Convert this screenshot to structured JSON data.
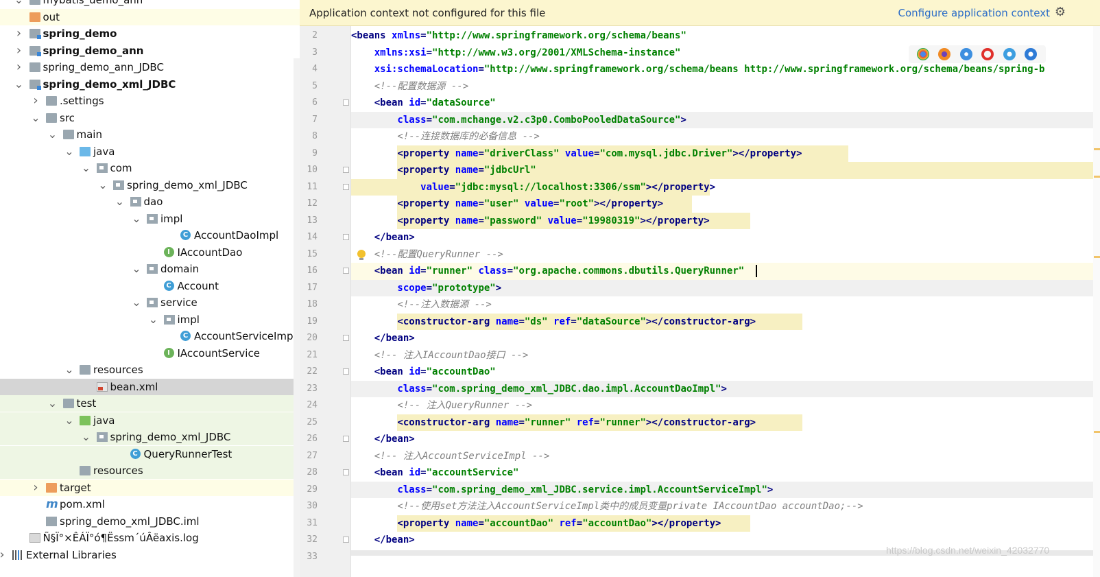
{
  "tree": {
    "items": [
      {
        "label": "mybatis_demo_ann",
        "arrow": "v",
        "icon": "folder-icon",
        "bold": false
      },
      {
        "label": "out",
        "arrow": "",
        "icon": "folder-icon",
        "bold": false
      },
      {
        "label": "spring_demo",
        "arrow": ">",
        "icon": "folder-icon",
        "bold": true
      },
      {
        "label": "spring_demo_ann",
        "arrow": ">",
        "icon": "folder-icon",
        "bold": true
      },
      {
        "label": "spring_demo_ann_JDBC",
        "arrow": ">",
        "icon": "folder-icon",
        "bold": false
      },
      {
        "label": "spring_demo_xml_JDBC",
        "arrow": "v",
        "icon": "folder-icon",
        "bold": true
      },
      {
        "label": ".settings",
        "arrow": ">",
        "icon": "folder-icon",
        "bold": false
      },
      {
        "label": "src",
        "arrow": "v",
        "icon": "folder-icon",
        "bold": false
      },
      {
        "label": "main",
        "arrow": "v",
        "icon": "folder-icon",
        "bold": false
      },
      {
        "label": "java",
        "arrow": "v",
        "icon": "folder-icon",
        "bold": false
      },
      {
        "label": "com",
        "arrow": "v",
        "icon": "package-icon",
        "bold": false
      },
      {
        "label": "spring_demo_xml_JDBC",
        "arrow": "v",
        "icon": "package-icon",
        "bold": false
      },
      {
        "label": "dao",
        "arrow": "v",
        "icon": "package-icon",
        "bold": false
      },
      {
        "label": "impl",
        "arrow": "v",
        "icon": "package-icon",
        "bold": false
      },
      {
        "label": "AccountDaoImpl",
        "arrow": "",
        "icon": "class-icon",
        "bold": false
      },
      {
        "label": "IAccountDao",
        "arrow": "",
        "icon": "interface-icon",
        "bold": false
      },
      {
        "label": "domain",
        "arrow": "v",
        "icon": "package-icon",
        "bold": false
      },
      {
        "label": "Account",
        "arrow": "",
        "icon": "class-icon",
        "bold": false
      },
      {
        "label": "service",
        "arrow": "v",
        "icon": "package-icon",
        "bold": false
      },
      {
        "label": "impl",
        "arrow": "v",
        "icon": "package-icon",
        "bold": false
      },
      {
        "label": "AccountServiceImpl",
        "arrow": "",
        "icon": "class-icon",
        "bold": false
      },
      {
        "label": "IAccountService",
        "arrow": "",
        "icon": "interface-icon",
        "bold": false
      },
      {
        "label": "resources",
        "arrow": "v",
        "icon": "folder-icon",
        "bold": false
      },
      {
        "label": "bean.xml",
        "arrow": "",
        "icon": "xml-file-icon",
        "bold": false
      },
      {
        "label": "test",
        "arrow": "v",
        "icon": "folder-icon",
        "bold": false
      },
      {
        "label": "java",
        "arrow": "v",
        "icon": "folder-icon",
        "bold": false
      },
      {
        "label": "spring_demo_xml_JDBC",
        "arrow": "v",
        "icon": "package-icon",
        "bold": false
      },
      {
        "label": "QueryRunnerTest",
        "arrow": "",
        "icon": "test-class-icon",
        "bold": false
      },
      {
        "label": "resources",
        "arrow": "",
        "icon": "folder-icon",
        "bold": false
      },
      {
        "label": "target",
        "arrow": ">",
        "icon": "folder-icon",
        "bold": false
      },
      {
        "label": "pom.xml",
        "arrow": "",
        "icon": "maven-icon",
        "bold": false
      },
      {
        "label": "spring_demo_xml_JDBC.iml",
        "arrow": "",
        "icon": "iml-file-icon",
        "bold": false
      },
      {
        "label": "Ñ§Ï°×ÊÁÏ°ó¶Ëssm´úÂëaxis.log",
        "arrow": "",
        "icon": "log-file-icon",
        "bold": false
      },
      {
        "label": "External Libraries",
        "arrow": ">",
        "icon": "library-icon",
        "bold": false
      }
    ]
  },
  "banner": {
    "message": "Application context not configured for this file",
    "link": "Configure application context"
  },
  "editor": {
    "line_numbers": [
      "2",
      "3",
      "4",
      "5",
      "6",
      "7",
      "8",
      "9",
      "10",
      "11",
      "12",
      "13",
      "14",
      "15",
      "16",
      "17",
      "18",
      "19",
      "20",
      "21",
      "22",
      "23",
      "24",
      "25",
      "26",
      "27",
      "28",
      "29",
      "30",
      "31",
      "32",
      "33"
    ],
    "lines": [
      [
        [
          "tag",
          "<beans "
        ],
        [
          "attr",
          "xmlns"
        ],
        [
          "tag",
          "="
        ],
        [
          "val",
          "\"http://www.springframework.org/schema/beans\""
        ]
      ],
      [
        [
          "attr",
          "    xmlns:xsi"
        ],
        [
          "tag",
          "="
        ],
        [
          "val",
          "\"http://www.w3.org/2001/XMLSchema-instance\""
        ]
      ],
      [
        [
          "attr",
          "    xsi:schemaLocation"
        ],
        [
          "tag",
          "="
        ],
        [
          "val",
          "\"http://www.springframework.org/schema/beans http://www.springframework.org/schema/beans/spring-b"
        ]
      ],
      [
        [
          "cmt",
          "    <!--配置数据源 -->"
        ]
      ],
      [
        [
          "tag",
          "    <bean "
        ],
        [
          "attr",
          "id"
        ],
        [
          "tag",
          "="
        ],
        [
          "val",
          "\"dataSource\""
        ]
      ],
      [
        [
          "attr",
          "        class"
        ],
        [
          "tag",
          "="
        ],
        [
          "val",
          "\"com.mchange.v2.c3p0.ComboPooledDataSource\""
        ],
        [
          "tag",
          ">"
        ]
      ],
      [
        [
          "cmt",
          "        <!--连接数据库的必备信息 -->"
        ]
      ],
      [
        [
          "tag",
          "        <property "
        ],
        [
          "attr",
          "name"
        ],
        [
          "tag",
          "="
        ],
        [
          "val",
          "\"driverClass\" "
        ],
        [
          "attr",
          "value"
        ],
        [
          "tag",
          "="
        ],
        [
          "val",
          "\"com.mysql.jdbc.Driver\""
        ],
        [
          "tag",
          "></property>"
        ]
      ],
      [
        [
          "tag",
          "        <property "
        ],
        [
          "attr",
          "name"
        ],
        [
          "tag",
          "="
        ],
        [
          "val",
          "\"jdbcUrl\""
        ]
      ],
      [
        [
          "attr",
          "            value"
        ],
        [
          "tag",
          "="
        ],
        [
          "val",
          "\"jdbc:mysql://localhost:3306/ssm\""
        ],
        [
          "tag",
          "></property>"
        ]
      ],
      [
        [
          "tag",
          "        <property "
        ],
        [
          "attr",
          "name"
        ],
        [
          "tag",
          "="
        ],
        [
          "val",
          "\"user\" "
        ],
        [
          "attr",
          "value"
        ],
        [
          "tag",
          "="
        ],
        [
          "val",
          "\"root\""
        ],
        [
          "tag",
          "></property>"
        ]
      ],
      [
        [
          "tag",
          "        <property "
        ],
        [
          "attr",
          "name"
        ],
        [
          "tag",
          "="
        ],
        [
          "val",
          "\"password\" "
        ],
        [
          "attr",
          "value"
        ],
        [
          "tag",
          "="
        ],
        [
          "val",
          "\"19980319\""
        ],
        [
          "tag",
          "></property>"
        ]
      ],
      [
        [
          "tag",
          "    </bean>"
        ]
      ],
      [
        [
          "cmt",
          "    <!--配置QueryRunner -->"
        ]
      ],
      [
        [
          "tag",
          "    <bean "
        ],
        [
          "attr",
          "id"
        ],
        [
          "tag",
          "="
        ],
        [
          "val",
          "\"runner\" "
        ],
        [
          "attr",
          "class"
        ],
        [
          "tag",
          "="
        ],
        [
          "val",
          "\"org.apache.commons.dbutils.QueryRunner\""
        ]
      ],
      [
        [
          "attr",
          "        scope"
        ],
        [
          "tag",
          "="
        ],
        [
          "val",
          "\"prototype\""
        ],
        [
          "tag",
          ">"
        ]
      ],
      [
        [
          "cmt",
          "        <!--注入数据源 -->"
        ]
      ],
      [
        [
          "tag",
          "        <constructor-arg "
        ],
        [
          "attr",
          "name"
        ],
        [
          "tag",
          "="
        ],
        [
          "val",
          "\"ds\" "
        ],
        [
          "attr",
          "ref"
        ],
        [
          "tag",
          "="
        ],
        [
          "val",
          "\"dataSource\""
        ],
        [
          "tag",
          "></constructor-arg>"
        ]
      ],
      [
        [
          "tag",
          "    </bean>"
        ]
      ],
      [
        [
          "cmt",
          "    <!-- 注入IAccountDao接口 -->"
        ]
      ],
      [
        [
          "tag",
          "    <bean "
        ],
        [
          "attr",
          "id"
        ],
        [
          "tag",
          "="
        ],
        [
          "val",
          "\"accountDao\""
        ]
      ],
      [
        [
          "attr",
          "        class"
        ],
        [
          "tag",
          "="
        ],
        [
          "val",
          "\"com.spring_demo_xml_JDBC.dao.impl.AccountDaoImpl\""
        ],
        [
          "tag",
          ">"
        ]
      ],
      [
        [
          "cmt",
          "        <!-- 注入QueryRunner -->"
        ]
      ],
      [
        [
          "tag",
          "        <constructor-arg "
        ],
        [
          "attr",
          "name"
        ],
        [
          "tag",
          "="
        ],
        [
          "val",
          "\"runner\" "
        ],
        [
          "attr",
          "ref"
        ],
        [
          "tag",
          "="
        ],
        [
          "val",
          "\"runner\""
        ],
        [
          "tag",
          "></constructor-arg>"
        ]
      ],
      [
        [
          "tag",
          "    </bean>"
        ]
      ],
      [
        [
          "cmt",
          "    <!-- 注入AccountServiceImpl -->"
        ]
      ],
      [
        [
          "tag",
          "    <bean "
        ],
        [
          "attr",
          "id"
        ],
        [
          "tag",
          "="
        ],
        [
          "val",
          "\"accountService\""
        ]
      ],
      [
        [
          "attr",
          "        class"
        ],
        [
          "tag",
          "="
        ],
        [
          "val",
          "\"com.spring_demo_xml_JDBC.service.impl.AccountServiceImpl\""
        ],
        [
          "tag",
          ">"
        ]
      ],
      [
        [
          "cmt",
          "        <!--使用set方法注入AccountServiceImpl类中的成员变量private IAccountDao accountDao;-->"
        ]
      ],
      [
        [
          "tag",
          "        <property "
        ],
        [
          "attr",
          "name"
        ],
        [
          "tag",
          "="
        ],
        [
          "val",
          "\"accountDao\" "
        ],
        [
          "attr",
          "ref"
        ],
        [
          "tag",
          "="
        ],
        [
          "val",
          "\"accountDao\""
        ],
        [
          "tag",
          "></property>"
        ]
      ],
      [
        [
          "tag",
          "    </bean>"
        ]
      ],
      []
    ]
  },
  "watermark": "https://blog.csdn.net/weixin_42032770",
  "colors": {
    "tag": "#000080",
    "attr": "#0000ff",
    "value": "#008000",
    "comment": "#808080",
    "banner_bg": "#fcf6cf"
  }
}
